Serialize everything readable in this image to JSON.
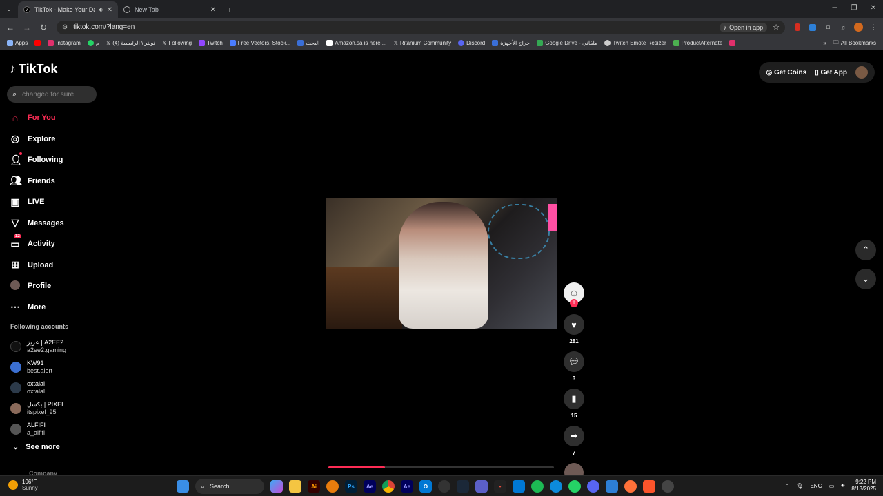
{
  "browser": {
    "tabs": [
      {
        "title": "TikTok - Make Your Day",
        "active": true
      },
      {
        "title": "New Tab",
        "active": false
      }
    ],
    "url": "tiktok.com/?lang=en",
    "open_in_app": "Open in app",
    "bookmarks": [
      {
        "label": "Apps",
        "color": "#8ab4f8"
      },
      {
        "label": "",
        "color": "#ff0000"
      },
      {
        "label": "Instagram",
        "color": "#e1306c"
      },
      {
        "label": "م",
        "color": "#25d366"
      },
      {
        "label": "تويتر \\ الرئيسية (4)",
        "color": "#ffffff"
      },
      {
        "label": "Following",
        "color": "#ffffff"
      },
      {
        "label": "Twitch",
        "color": "#9146ff"
      },
      {
        "label": "Free Vectors, Stock...",
        "color": "#4a7dff"
      },
      {
        "label": "البحث",
        "color": "#3a6fd8"
      },
      {
        "label": "Amazon.sa is here|...",
        "color": "#ffffff"
      },
      {
        "label": "Ritanium Community",
        "color": "#ffffff"
      },
      {
        "label": "Discord",
        "color": "#5865f2"
      },
      {
        "label": "حراج الأجهزة",
        "color": "#3a6fd8"
      },
      {
        "label": "Google Drive - ملفاتي",
        "color": "#34a853"
      },
      {
        "label": "Twitch Emote Resizer",
        "color": "#cccccc"
      },
      {
        "label": "ProductAlternate",
        "color": "#4caf50"
      },
      {
        "label": "",
        "color": "#e1306c"
      }
    ],
    "all_bookmarks": "All Bookmarks"
  },
  "tiktok": {
    "logo": "TikTok",
    "search_placeholder": "changed for sure",
    "nav": [
      {
        "label": "For You",
        "icon": "home-icon",
        "active": true
      },
      {
        "label": "Explore",
        "icon": "compass-icon"
      },
      {
        "label": "Following",
        "icon": "following-icon"
      },
      {
        "label": "Friends",
        "icon": "friends-icon"
      },
      {
        "label": "LIVE",
        "icon": "live-icon"
      },
      {
        "label": "Messages",
        "icon": "messages-icon"
      },
      {
        "label": "Activity",
        "icon": "activity-icon",
        "badge": "12"
      },
      {
        "label": "Upload",
        "icon": "upload-icon"
      },
      {
        "label": "Profile",
        "icon": "profile-avatar"
      },
      {
        "label": "More",
        "icon": "more-icon"
      }
    ],
    "following_title": "Following accounts",
    "following": [
      {
        "name": "عزيز | A2EE2",
        "handle": "a2ee2.gaming"
      },
      {
        "name": "KW91",
        "handle": "best.alert"
      },
      {
        "name": "oxtalal",
        "handle": "oxtalal"
      },
      {
        "name": "بكسل | PIXEL",
        "handle": "itspixel_95"
      },
      {
        "name": "ALFIFI",
        "handle": "a_alfifi"
      }
    ],
    "see_more": "See more",
    "company": "Company",
    "get_coins": "Get Coins",
    "get_app": "Get App",
    "actions": {
      "likes": "281",
      "comments": "3",
      "saves": "15",
      "shares": "7"
    },
    "progress_fraction": 0.25
  },
  "taskbar": {
    "temp": "106°F",
    "weather": "Sunny",
    "search": "Search",
    "lang": "ENG",
    "time": "9:22 PM",
    "date": "8/13/2025"
  }
}
